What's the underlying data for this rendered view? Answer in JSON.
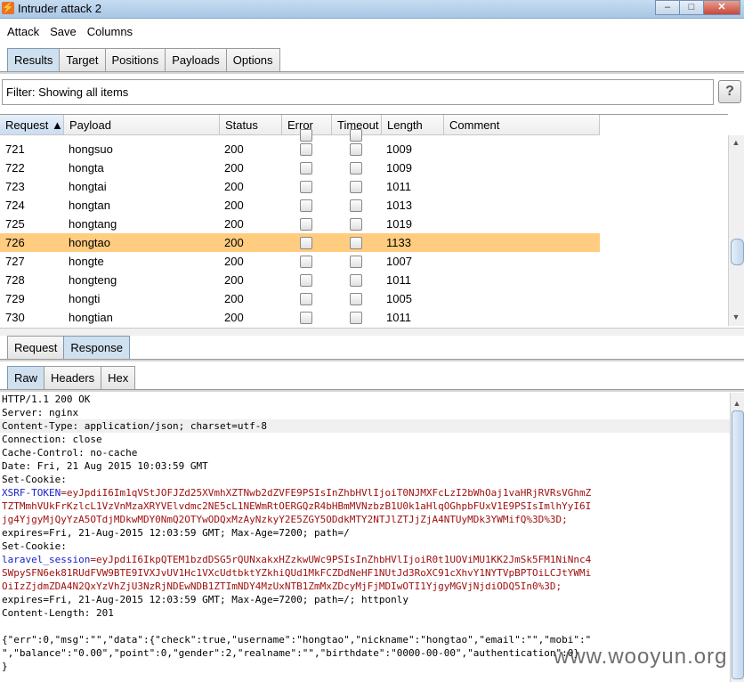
{
  "window": {
    "title": "Intruder attack 2",
    "minimize": "–",
    "maximize": "□",
    "close": "✕",
    "app_icon": "⚡"
  },
  "menu": [
    "Attack",
    "Save",
    "Columns"
  ],
  "main_tabs": [
    "Results",
    "Target",
    "Positions",
    "Payloads",
    "Options"
  ],
  "filter": {
    "text": "Filter: Showing all items",
    "help": "?"
  },
  "table": {
    "columns": [
      "Request ▲",
      "Payload",
      "Status",
      "Error",
      "Timeout",
      "Length",
      "Comment"
    ],
    "rows": [
      {
        "request": "721",
        "payload": "hongsuo",
        "status": "200",
        "length": "1009"
      },
      {
        "request": "722",
        "payload": "hongta",
        "status": "200",
        "length": "1009"
      },
      {
        "request": "723",
        "payload": "hongtai",
        "status": "200",
        "length": "1011"
      },
      {
        "request": "724",
        "payload": "hongtan",
        "status": "200",
        "length": "1013"
      },
      {
        "request": "725",
        "payload": "hongtang",
        "status": "200",
        "length": "1019"
      },
      {
        "request": "726",
        "payload": "hongtao",
        "status": "200",
        "length": "1133",
        "selected": true
      },
      {
        "request": "727",
        "payload": "hongte",
        "status": "200",
        "length": "1007"
      },
      {
        "request": "728",
        "payload": "hongteng",
        "status": "200",
        "length": "1011"
      },
      {
        "request": "729",
        "payload": "hongti",
        "status": "200",
        "length": "1005"
      },
      {
        "request": "730",
        "payload": "hongtian",
        "status": "200",
        "length": "1011"
      }
    ],
    "selected_color": "#ffcc80"
  },
  "detail_tabs": [
    "Request",
    "Response"
  ],
  "view_tabs": [
    "Raw",
    "Headers",
    "Hex"
  ],
  "response": {
    "lines": [
      "HTTP/1.1 200 OK",
      "Server: nginx",
      "Content-Type: application/json; charset=utf-8",
      "Connection: close",
      "Cache-Control: no-cache",
      "Date: Fri, 21 Aug 2015 10:03:59 GMT",
      "Set-Cookie:"
    ],
    "xsrf_key": "XSRF-TOKEN",
    "xsrf_value_1": "=eyJpdiI6Im1qVStJOFJZd25XVmhXZTNwb2dZVFE9PSIsInZhbHVlIjoiT0NJMXFcLzI2bWhOaj1vaHRjRVRsVGhmZ",
    "xsrf_value_2": "TZTMmhVUkFrKzlcL1VzVnMzaXRYVElvdmc2NE5cL1NEWmRtOERGQzR4bHBmMVNzbzB1U0k1aHlqOGhpbFUxV1E9PSIsImlhYyI6I",
    "xsrf_value_3": "jg4YjgyMjQyYzA5OTdjMDkwMDY0NmQ2OTYwODQxMzAyNzkyY2E5ZGY5ODdkMTY2NTJlZTJjZjA4NTUyMDk3YWMifQ%3D%3D;",
    "expires_1": "expires=Fri, 21-Aug-2015 12:03:59 GMT; Max-Age=7200; path=/",
    "set_cookie_2": "Set-Cookie:",
    "laravel_key": "laravel_session",
    "laravel_value_1": "=eyJpdiI6IkpQTEM1bzdDSG5rQUNxakxHZzkwUWc9PSIsInZhbHVlIjoiR0t1UOViMU1KK2JmSk5FM1NiNnc4",
    "laravel_value_2": "SWpySFN6ek81RUdFVW9BTE9IVXJvUV1Hc1VXcUdtbktYZkhiQUd1MkFCZDdNeHF1NUtJd3RoXC91cXhvY1NYTVpBPTOiLCJtYWMi",
    "laravel_value_3": "OiIzZjdmZDA4N2QxYzVhZjU3NzRjNDEwNDB1ZTImNDY4MzUxNTB1ZmMxZDcyMjFjMDIwOTI1YjgyMGVjNjdiODQ5In0%3D;",
    "expires_2": "expires=Fri, 21-Aug-2015 12:03:59 GMT; Max-Age=7200; path=/; httponly",
    "content_length": "Content-Length: 201",
    "json_1": "{\"err\":0,\"msg\":\"\",\"data\":{\"check\":true,\"username\":\"hongtao\",\"nickname\":\"hongtao\",\"email\":\"\",\"mobi\":\"",
    "json_2": "\",\"balance\":\"0.00\",\"point\":0,\"gender\":2,\"realname\":\"\",\"birthdate\":\"0000-00-00\",\"authentication\":0}",
    "json_3": "}"
  },
  "watermark": "www.wooyun.org"
}
